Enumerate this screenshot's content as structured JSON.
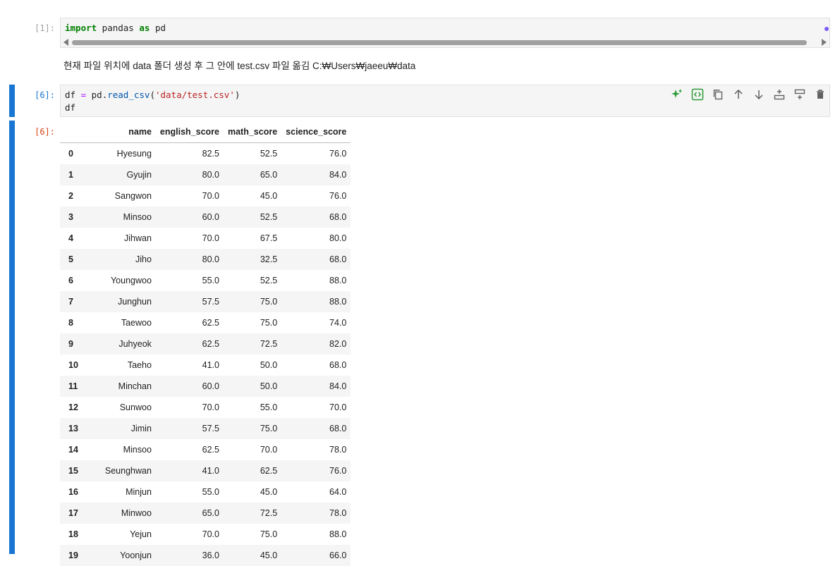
{
  "cells": {
    "import_cell": {
      "prompt": "[1]:",
      "code": {
        "kw_import": "import",
        "module": " pandas ",
        "kw_as": "as",
        "alias": " pd"
      }
    },
    "markdown_text": "현재 파일 위치에 data 폴더 생성 후 그 안에 test.csv 파일 옮김 C:₩Users₩jaeeu₩data",
    "read_cell": {
      "prompt": "[6]:",
      "code_line1": {
        "var": "df",
        "eq": " = ",
        "obj": "pd.",
        "func": "read_csv",
        "open": "(",
        "arg": "'data/test.csv'",
        "close": ")"
      },
      "code_line2": "df"
    },
    "output": {
      "prompt": "[6]:"
    }
  },
  "toolbar_icons": [
    "sparkle-icon",
    "code-toggle-icon",
    "copy-icon",
    "arrow-up-icon",
    "arrow-down-icon",
    "insert-above-icon",
    "insert-below-icon",
    "trash-icon"
  ],
  "colors": {
    "accent": "#1976d2",
    "sparkle": "#2e9c3a",
    "dirty": "#7c5cf6"
  },
  "dataframe": {
    "columns": [
      "name",
      "english_score",
      "math_score",
      "science_score"
    ],
    "rows": [
      [
        "0",
        "Hyesung",
        "82.5",
        "52.5",
        "76.0"
      ],
      [
        "1",
        "Gyujin",
        "80.0",
        "65.0",
        "84.0"
      ],
      [
        "2",
        "Sangwon",
        "70.0",
        "45.0",
        "76.0"
      ],
      [
        "3",
        "Minsoo",
        "60.0",
        "52.5",
        "68.0"
      ],
      [
        "4",
        "Jihwan",
        "70.0",
        "67.5",
        "80.0"
      ],
      [
        "5",
        "Jiho",
        "80.0",
        "32.5",
        "68.0"
      ],
      [
        "6",
        "Youngwoo",
        "55.0",
        "52.5",
        "88.0"
      ],
      [
        "7",
        "Junghun",
        "57.5",
        "75.0",
        "88.0"
      ],
      [
        "8",
        "Taewoo",
        "62.5",
        "75.0",
        "74.0"
      ],
      [
        "9",
        "Juhyeok",
        "62.5",
        "72.5",
        "82.0"
      ],
      [
        "10",
        "Taeho",
        "41.0",
        "50.0",
        "68.0"
      ],
      [
        "11",
        "Minchan",
        "60.0",
        "50.0",
        "84.0"
      ],
      [
        "12",
        "Sunwoo",
        "70.0",
        "55.0",
        "70.0"
      ],
      [
        "13",
        "Jimin",
        "57.5",
        "75.0",
        "68.0"
      ],
      [
        "14",
        "Minsoo",
        "62.5",
        "70.0",
        "78.0"
      ],
      [
        "15",
        "Seunghwan",
        "41.0",
        "62.5",
        "76.0"
      ],
      [
        "16",
        "Minjun",
        "55.0",
        "45.0",
        "64.0"
      ],
      [
        "17",
        "Minwoo",
        "65.0",
        "72.5",
        "78.0"
      ],
      [
        "18",
        "Yejun",
        "70.0",
        "75.0",
        "88.0"
      ],
      [
        "19",
        "Yoonjun",
        "36.0",
        "45.0",
        "66.0"
      ]
    ]
  }
}
